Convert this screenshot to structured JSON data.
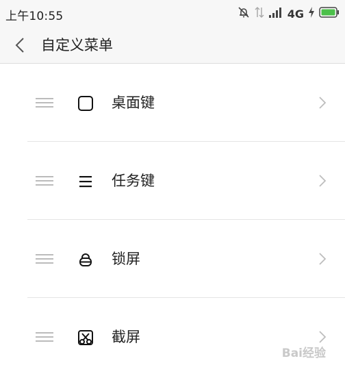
{
  "status_bar": {
    "time": "上午10:55",
    "network": "4G",
    "icons": [
      "mute-icon",
      "data-arrows-icon",
      "signal-icon",
      "charging-icon",
      "battery-icon"
    ]
  },
  "header": {
    "back_icon": "chevron-left-icon",
    "title": "自定义菜单"
  },
  "menu_items": [
    {
      "label": "桌面键",
      "icon": "home-square-icon"
    },
    {
      "label": "任务键",
      "icon": "task-lines-icon"
    },
    {
      "label": "锁屏",
      "icon": "lock-icon"
    },
    {
      "label": "截屏",
      "icon": "screenshot-scissors-icon"
    }
  ],
  "watermark": "Bai经验",
  "colors": {
    "bar_bg": "#f7f7f7",
    "battery": "#4cc04a",
    "separator": "#e4e4e4",
    "handle": "#bbbbbb",
    "chevron": "#bdbdbd"
  }
}
